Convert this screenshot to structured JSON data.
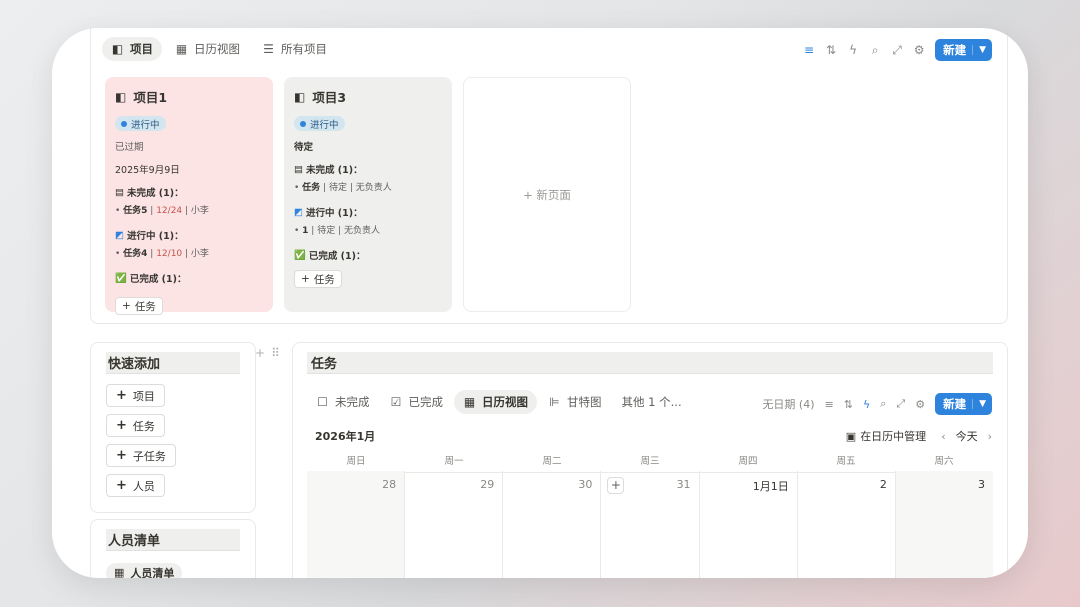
{
  "board": {
    "tabs": [
      {
        "label": "项目",
        "icon": "board-icon"
      },
      {
        "label": "日历视图",
        "icon": "calendar-icon"
      },
      {
        "label": "所有项目",
        "icon": "list-icon"
      }
    ],
    "new_label": "新建",
    "cards": [
      {
        "title": "项目1",
        "status": "进行中",
        "overdue": "已过期",
        "date": "2025年9月9日",
        "groups": [
          {
            "head": "未完成 (1)：",
            "task": "任务5",
            "due": "12/24",
            "owner": "小李"
          },
          {
            "head": "进行中 (1)：",
            "task": "任务4",
            "due": "12/10",
            "owner": "小李"
          },
          {
            "head": "已完成 (1)："
          }
        ],
        "add_label": "任务"
      },
      {
        "title": "项目3",
        "status": "进行中",
        "pending": "待定",
        "groups": [
          {
            "head": "未完成 (1)：",
            "task": "任务",
            "due": "待定",
            "owner": "无负责人"
          },
          {
            "head": "进行中 (1)：",
            "task": "1",
            "due": "待定",
            "owner": "无负责人"
          },
          {
            "head": "已完成 (1)："
          }
        ],
        "add_label": "任务"
      }
    ],
    "new_page": "+ 新页面"
  },
  "quick_add": {
    "title": "快速添加",
    "buttons": [
      "项目",
      "任务",
      "子任务",
      "人员"
    ]
  },
  "people": {
    "title": "人员清单",
    "chip": "人员清单"
  },
  "tasks": {
    "title": "任务",
    "tabs": [
      {
        "label": "未完成",
        "icon": "checkbox-empty-icon"
      },
      {
        "label": "已完成",
        "icon": "checkbox-checked-icon"
      },
      {
        "label": "日历视图",
        "icon": "calendar-icon"
      },
      {
        "label": "甘特图",
        "icon": "gantt-icon"
      }
    ],
    "more": "其他 1 个...",
    "undated": "无日期 (4)",
    "new_label": "新建",
    "month": "2026年1月",
    "manage": "在日历中管理",
    "today": "今天",
    "weekdays": [
      "周日",
      "周一",
      "周二",
      "周三",
      "周四",
      "周五",
      "周六"
    ],
    "days": [
      "28",
      "29",
      "30",
      "31",
      "1月1日",
      "2",
      "3"
    ]
  },
  "colors": {
    "accent": "#2e83dc",
    "card_pink": "#fbe4e3",
    "card_gray": "#efefed",
    "due_red": "#c4554d"
  }
}
